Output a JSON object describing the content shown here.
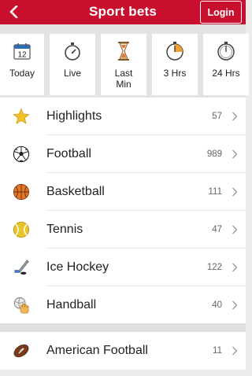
{
  "header": {
    "title": "Sport bets",
    "login_label": "Login",
    "bg_color": "#c8102e"
  },
  "filters": [
    {
      "label": "Today",
      "icon": "calendar-icon",
      "calendar_day": "12"
    },
    {
      "label": "Live",
      "icon": "stopwatch-icon"
    },
    {
      "label": "Last Min",
      "icon": "hourglass-icon"
    },
    {
      "label": "3 Hrs",
      "icon": "timer-quarter-icon"
    },
    {
      "label": "24 Hrs",
      "icon": "timer-full-icon"
    }
  ],
  "sports": [
    {
      "name": "Highlights",
      "count": "57",
      "icon": "star-icon"
    },
    {
      "name": "Football",
      "count": "989",
      "icon": "soccer-ball-icon"
    },
    {
      "name": "Basketball",
      "count": "111",
      "icon": "basketball-icon"
    },
    {
      "name": "Tennis",
      "count": "47",
      "icon": "tennis-ball-icon"
    },
    {
      "name": "Ice Hockey",
      "count": "122",
      "icon": "hockey-stick-icon"
    },
    {
      "name": "Handball",
      "count": "40",
      "icon": "handball-icon"
    }
  ],
  "sports_more": [
    {
      "name": "American Football",
      "count": "11",
      "icon": "american-football-icon"
    }
  ]
}
